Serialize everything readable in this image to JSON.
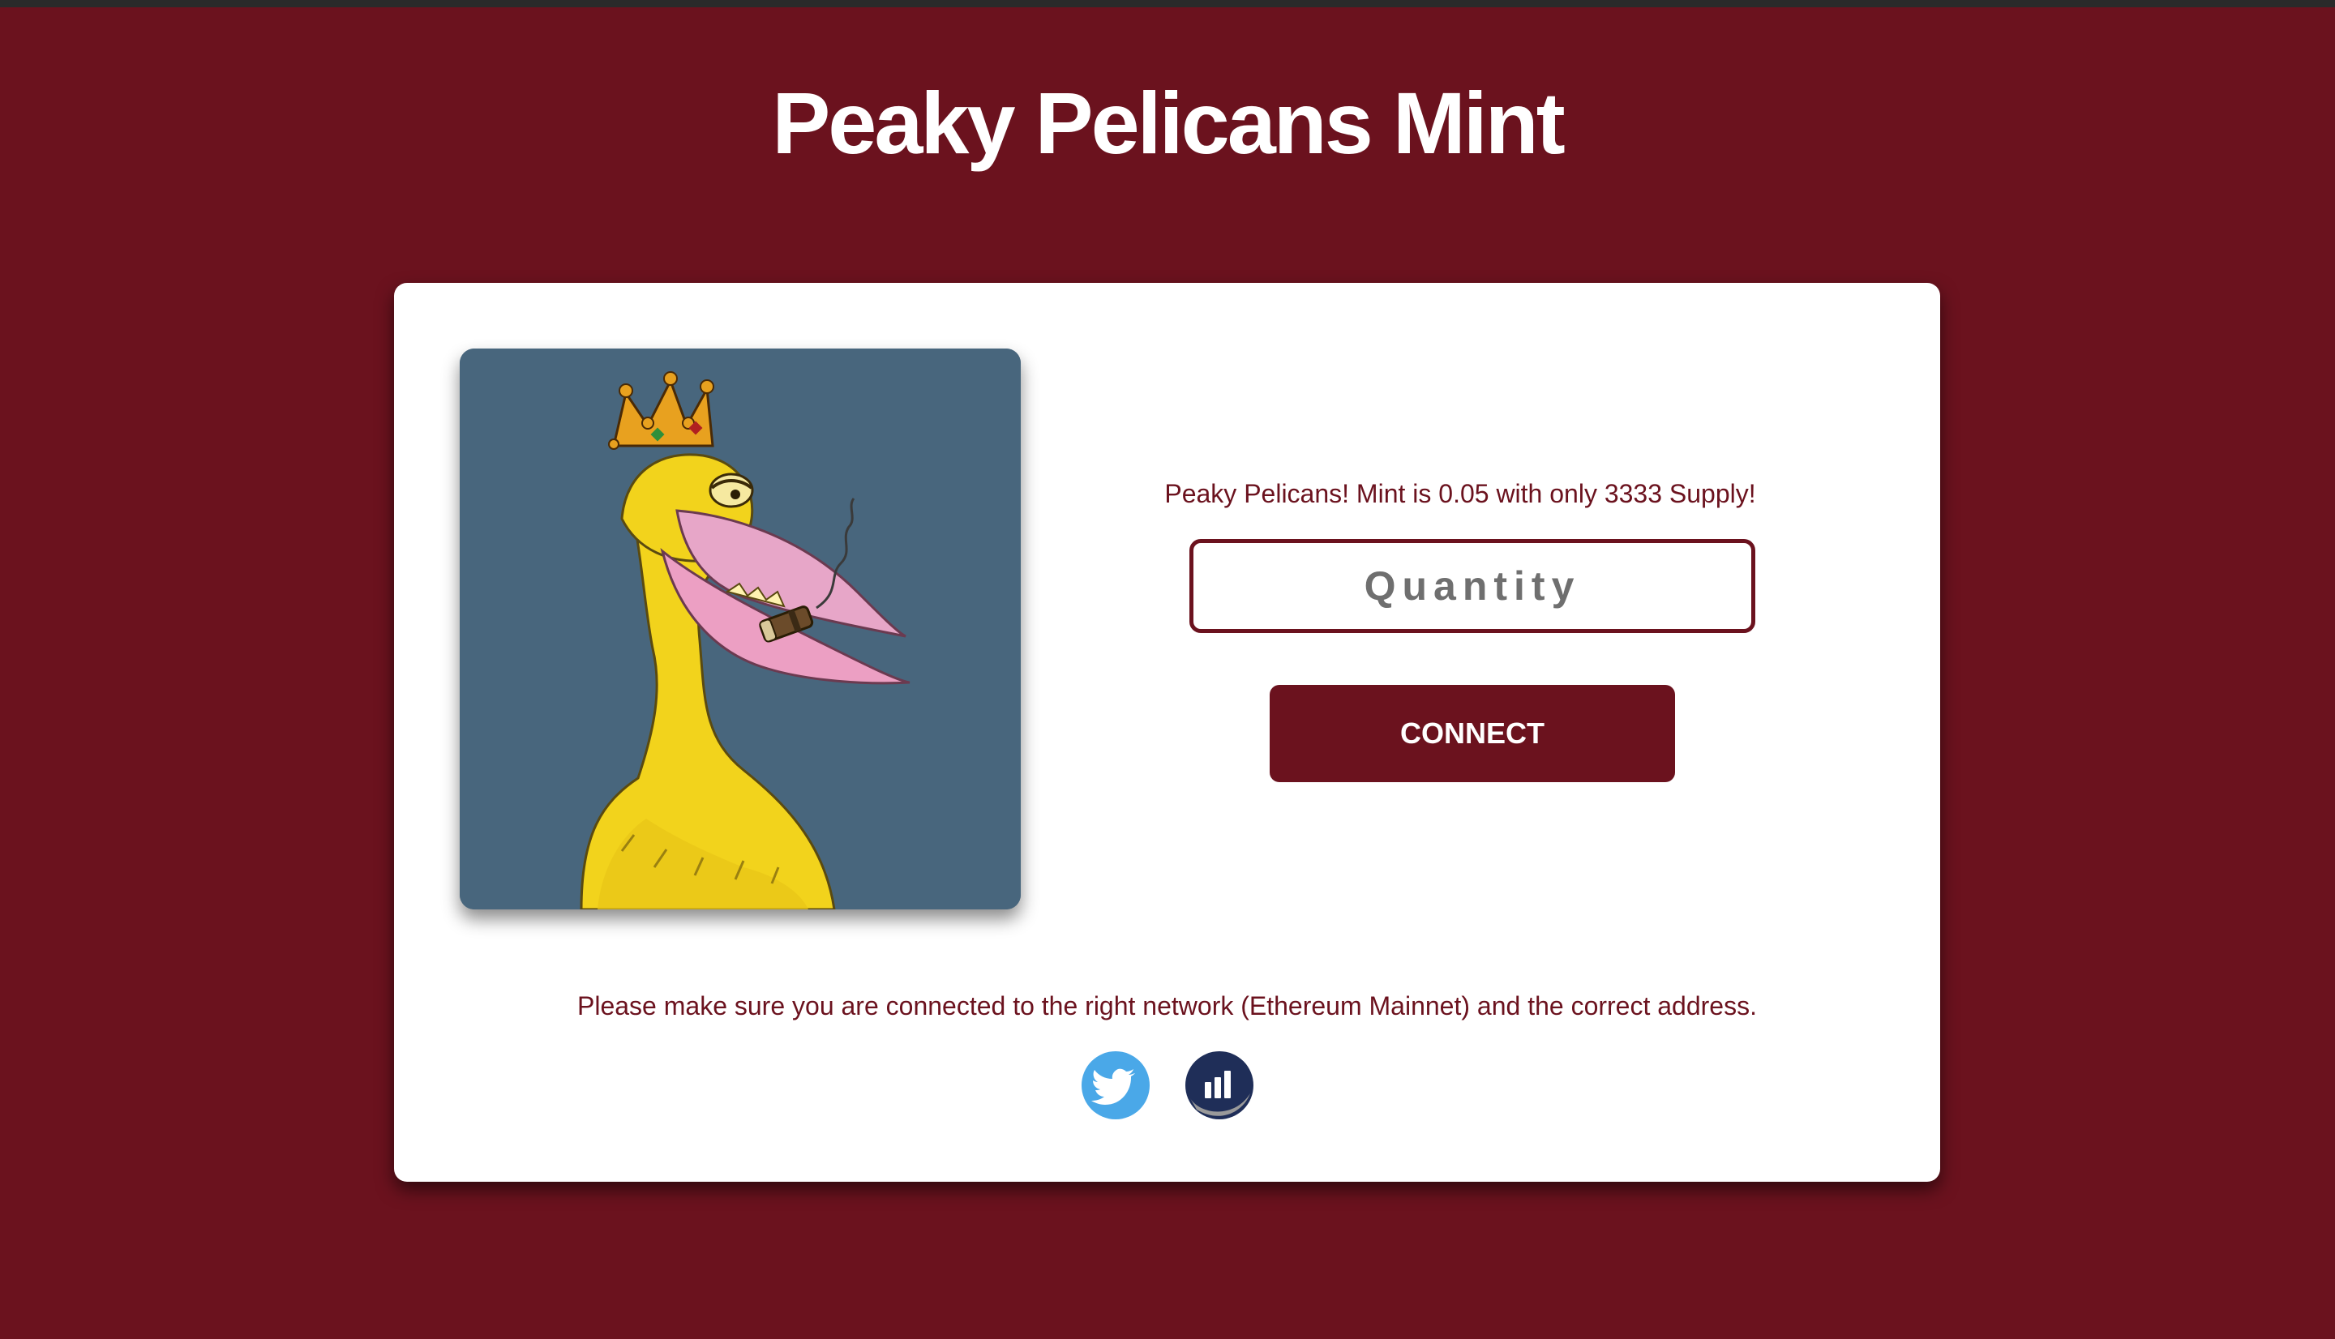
{
  "page": {
    "title": "Peaky Pelicans Mint"
  },
  "card": {
    "image_icon": "pelican-with-crown-and-cigar",
    "mint_info": "Peaky Pelicans! Mint is 0.05 with only 3333 Supply!",
    "quantity_placeholder": "Quantity",
    "quantity_value": "",
    "connect_label": "CONNECT",
    "network_note": "Please make sure you are connected to the right network (Ethereum Mainnet) and the correct address."
  },
  "social": [
    {
      "icon": "twitter-icon",
      "color": "#4aa8e8"
    },
    {
      "icon": "chart-tracker-icon",
      "color": "#1f2e58"
    }
  ],
  "colors": {
    "background": "#6b121e",
    "card": "#ffffff",
    "accent": "#6b121e",
    "image_background": "#48667d"
  }
}
